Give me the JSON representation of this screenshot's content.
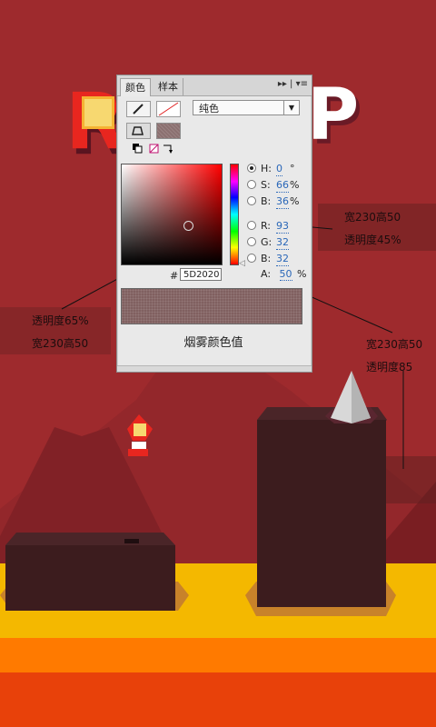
{
  "game": {
    "logo_left": "R",
    "logo_right": "P"
  },
  "panel": {
    "tab_color": "颜色",
    "tab_swatches": "样本",
    "tab_tools": "▸▸ | ▾≡",
    "fill_type": "纯色",
    "fields": [
      {
        "label": "H:",
        "value": "0",
        "unit": "°",
        "selected": true
      },
      {
        "label": "S:",
        "value": "66",
        "unit": "%",
        "selected": false
      },
      {
        "label": "B:",
        "value": "36",
        "unit": "%",
        "selected": false
      },
      {
        "label": "R:",
        "value": "93",
        "unit": "",
        "selected": false
      },
      {
        "label": "G:",
        "value": "32",
        "unit": "",
        "selected": false
      },
      {
        "label": "B:",
        "value": "32",
        "unit": "",
        "selected": false
      }
    ],
    "hex_prefix": "#",
    "hex_value": "5D2020",
    "alpha_label": "A:",
    "alpha_value": "50",
    "alpha_unit": "%",
    "caption": "烟雾颜色值"
  },
  "annotations": {
    "right_top_line1": "宽230高50",
    "right_top_line2": "透明度45%",
    "left_line1": "透明度65%",
    "left_line2": "宽230高50",
    "right_bottom_line1": "宽230高50",
    "right_bottom_line2": "透明度85"
  },
  "colors": {
    "sky": "#9e2a2d",
    "mountain": "#8b2226",
    "pillar": "#3c1c1e",
    "lava_yellow": "#f4b800",
    "lava_orange": "#ff7a00",
    "lava_red": "#e8410a"
  }
}
